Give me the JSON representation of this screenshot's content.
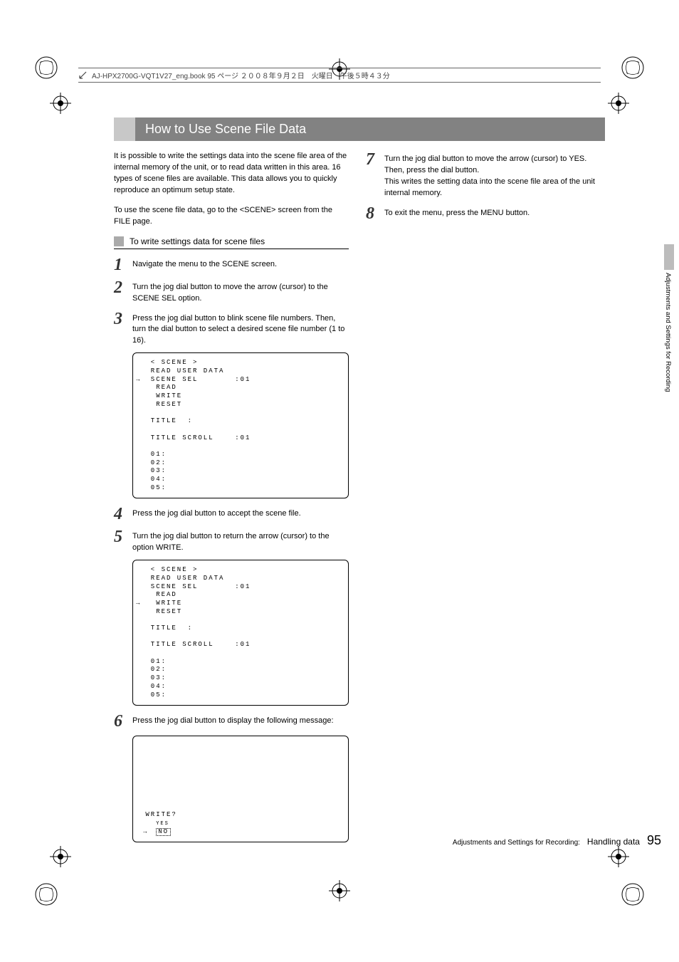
{
  "header": {
    "bookfile": "AJ-HPX2700G-VQT1V27_eng.book  95 ページ  ２００８年９月２日　火曜日　午後５時４３分"
  },
  "section_title": "How to Use Scene File Data",
  "intro": {
    "p1": "It is possible to write the settings data into the scene file area of the internal memory of the unit, or to read data written in this area. 16 types of scene files are available. This data allows you to quickly reproduce an optimum setup state.",
    "p2": "To use the scene file data, go to the <SCENE> screen from the FILE page."
  },
  "subhead": "To write settings data for scene files",
  "steps": {
    "s1": "Navigate the menu to the SCENE screen.",
    "s2": "Turn the jog dial button to move the arrow (cursor) to the SCENE SEL option.",
    "s3": "Press the jog dial button to blink scene file numbers. Then, turn the dial button to select a desired scene file number (1 to 16).",
    "s4": "Press the jog dial button to accept the scene file.",
    "s5": "Turn the jog dial button to return the arrow (cursor) to the option WRITE.",
    "s6": "Press the jog dial button to display the following message:",
    "s7a": "Turn the jog dial button to move the arrow (cursor) to YES. Then, press the dial button.",
    "s7b": "This writes the setting data into the scene file area of the unit internal memory.",
    "s8": "To exit the menu, press the MENU button."
  },
  "screens": {
    "sc1": {
      "l1": "  < SCENE >",
      "l2": "  READ USER DATA",
      "l3": "  SCENE SEL       :01",
      "l4": "   READ",
      "l5": "   WRITE",
      "l6": "   RESET",
      "blank1": "",
      "l7": "  TITLE  :",
      "blank2": "",
      "l8": "  TITLE SCROLL    :01",
      "blank3": "",
      "l9": "  01:",
      "l10": "  02:",
      "l11": "  03:",
      "l12": "  04:",
      "l13": "  05:"
    },
    "sc2": {
      "l1": "  < SCENE >",
      "l2": "  READ USER DATA",
      "l3": "  SCENE SEL       :01",
      "l4": "   READ",
      "l5": "   WRITE",
      "l6": "   RESET",
      "blank1": "",
      "l7": "  TITLE  :",
      "blank2": "",
      "l8": "  TITLE SCROLL    :01",
      "blank3": "",
      "l9": "  01:",
      "l10": "  02:",
      "l11": "  03:",
      "l12": "  04:",
      "l13": "  05:"
    },
    "sc3": {
      "prompt": " WRITE?",
      "yes": "YES",
      "no": "NO"
    }
  },
  "side_tab": "Adjustments and Settings for Recording",
  "footer": {
    "path": "Adjustments and Settings for Recording:",
    "subject": "Handling data",
    "page": "95"
  }
}
